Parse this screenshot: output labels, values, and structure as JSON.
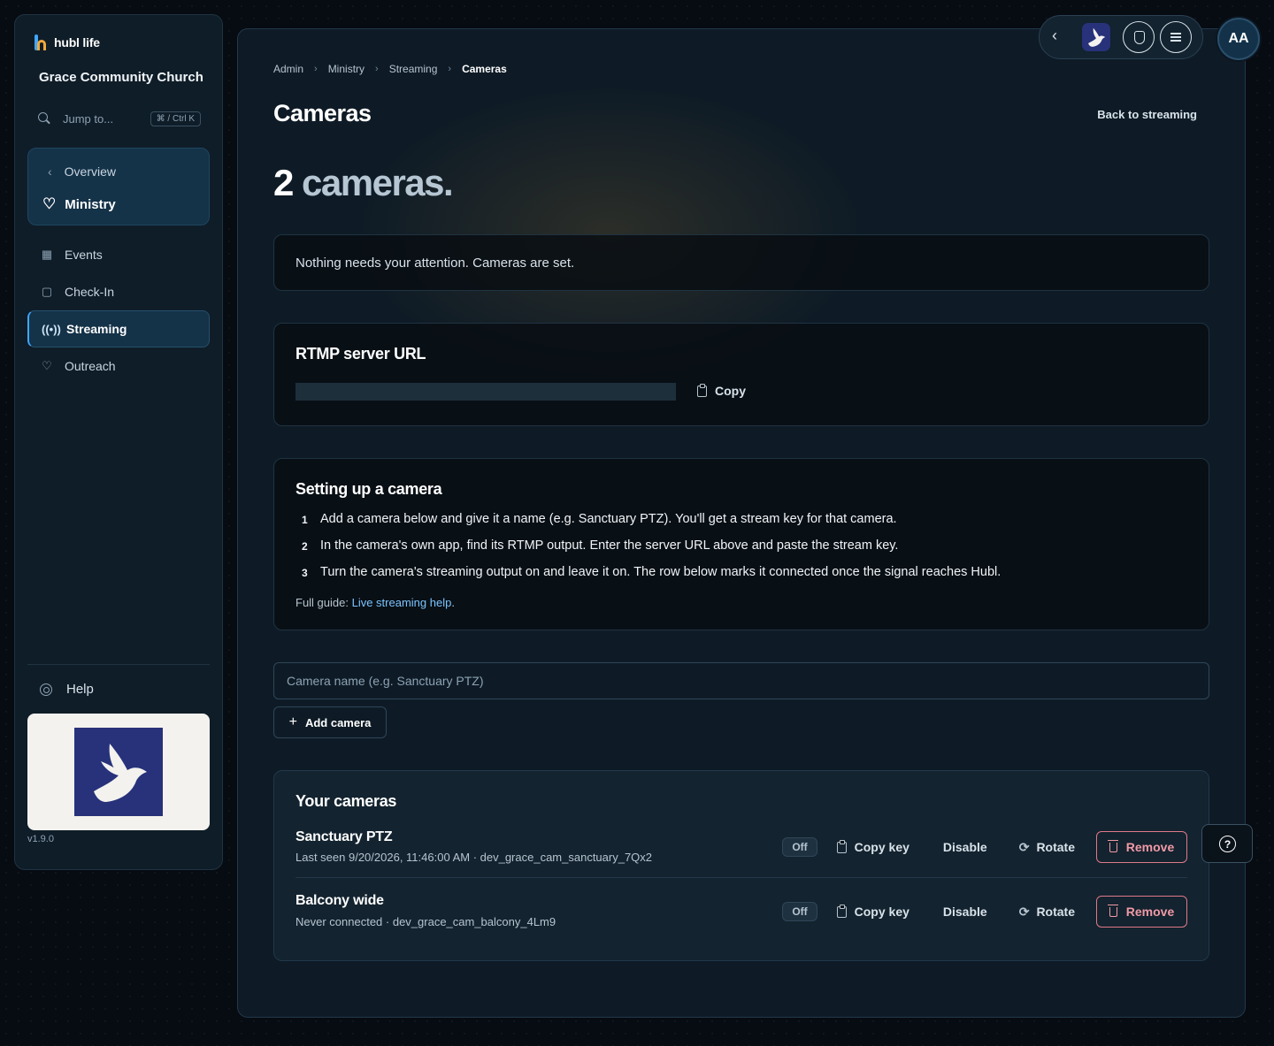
{
  "app": {
    "brand": "hubl life",
    "org_name": "Grace Community Church",
    "version": "v1.9.0"
  },
  "sidebar": {
    "jump_label": "Jump to...",
    "jump_shortcut": "⌘ / Ctrl K",
    "back_label": "Overview",
    "section_label": "Ministry",
    "items": [
      {
        "label": "Events",
        "icon": "calendar-icon"
      },
      {
        "label": "Check-In",
        "icon": "clipboard-icon"
      },
      {
        "label": "Streaming",
        "icon": "broadcast-icon",
        "active": true
      },
      {
        "label": "Outreach",
        "icon": "heart-icon"
      }
    ],
    "help_label": "Help"
  },
  "breadcrumb": [
    "Admin",
    "Ministry",
    "Streaming",
    "Cameras"
  ],
  "page": {
    "title": "Cameras",
    "back_link": "Back to streaming",
    "count_number": "2",
    "count_word": "cameras."
  },
  "notice": {
    "text": "Nothing needs your attention. Cameras are set."
  },
  "rtmp": {
    "title": "RTMP server URL",
    "copy_label": "Copy"
  },
  "setup": {
    "title": "Setting up a camera",
    "steps": [
      {
        "n": "1",
        "text": "Add a camera below and give it a name (e.g. Sanctuary PTZ). You'll get a stream key for that camera."
      },
      {
        "n": "2",
        "text": "In the camera's own app, find its RTMP output. Enter the server URL above and paste the stream key."
      },
      {
        "n": "3",
        "text": "Turn the camera's streaming output on and leave it on. The row below marks it connected once the signal reaches Hubl."
      }
    ],
    "guide_prefix": "Full guide: ",
    "guide_link": "Live streaming help",
    "guide_suffix": "."
  },
  "add_form": {
    "placeholder": "Camera name (e.g. Sanctuary PTZ)",
    "button_label": "Add camera"
  },
  "cameras": {
    "title": "Your cameras",
    "actions": {
      "status": "Off",
      "copy_key": "Copy key",
      "disable": "Disable",
      "rotate": "Rotate",
      "remove": "Remove"
    },
    "rows": [
      {
        "name": "Sanctuary PTZ",
        "meta": "Last seen 9/20/2026, 11:46:00 AM · dev_grace_cam_sanctuary_7Qx2"
      },
      {
        "name": "Balcony wide",
        "meta": "Never connected · dev_grace_cam_balcony_4Lm9"
      }
    ]
  },
  "topbar": {
    "avatar_initials": "AA"
  },
  "colors": {
    "accent": "#3fa7ff",
    "danger": "#f09aa6",
    "logo_bg": "#27327a"
  }
}
